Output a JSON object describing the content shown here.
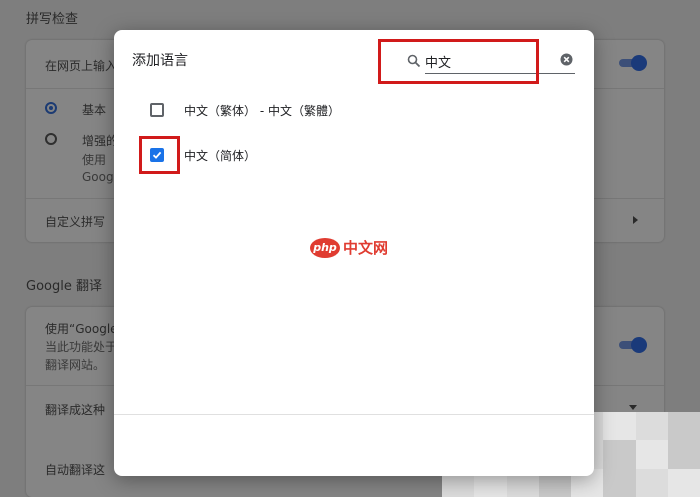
{
  "background": {
    "spellcheck_title": "拼写检查",
    "spellcheck_row": "在网页上输入",
    "radio_basic": "基本",
    "radio_enhanced": "增强的",
    "enhanced_line2": "使用",
    "enhanced_line3": "Goog",
    "custom_spell": "自定义拼写",
    "translate_title": "Google 翻译",
    "translate_line1": "使用“Google",
    "translate_line2": "当此功能处于",
    "translate_line3": "翻译网站。",
    "translate_target": "翻译成这种",
    "auto_translate": "自动翻译这"
  },
  "dialog": {
    "title": "添加语言",
    "search": {
      "value": "中文",
      "placeholder": ""
    },
    "languages": [
      {
        "label": "中文（繁体） - 中文（繁體）",
        "checked": false
      },
      {
        "label": "中文（简体）",
        "checked": true
      }
    ]
  },
  "watermark": {
    "logo": "php",
    "text": "中文网"
  },
  "colors": {
    "accent": "#1a73e8",
    "highlight": "#d11a1a",
    "watermark": "#e03c31"
  }
}
